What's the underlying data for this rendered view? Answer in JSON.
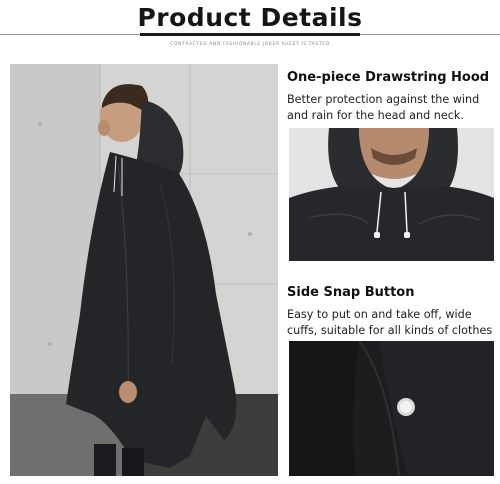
{
  "header": {
    "title": "Product Details",
    "subtitle": "CONTRACTED AND FASHIONABLE JOKER SHEET IS TASTED"
  },
  "features": [
    {
      "title": "One-piece Drawstring Hood",
      "desc_line1": "Better protection against the wind",
      "desc_line2": "and rain for the head and neck."
    },
    {
      "title": "Side Snap Button",
      "desc_line1": "Easy to put on and take off, wide",
      "desc_line2": "cuffs, suitable for all kinds of clothes"
    }
  ]
}
